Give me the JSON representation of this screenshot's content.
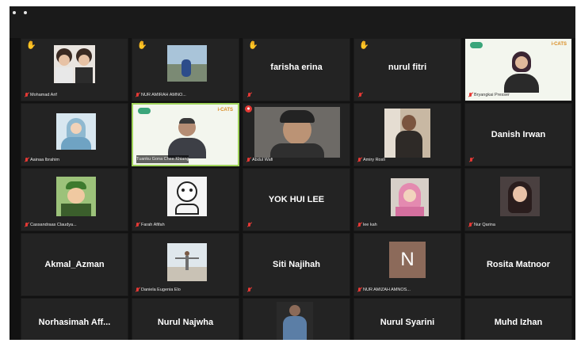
{
  "window": {
    "theme_bg": "#121212",
    "accent_active": "#9fd35a",
    "muted_color": "#e53935"
  },
  "participants": [
    {
      "label": "Mohamad Arif",
      "hand": true
    },
    {
      "label": "NUR AMIRAH AMNO...",
      "hand": true
    },
    {
      "name": "farisha erina",
      "hand": true
    },
    {
      "name": "nurul fitri",
      "hand": true
    },
    {
      "label": "Bryangkai Presser",
      "slide_brand": "i-CATS"
    },
    {
      "label": "Aainaa Ibrahim"
    },
    {
      "label": "Tuanku Gona Chee Khiang",
      "slide_brand": "i-CATS",
      "active": true
    },
    {
      "label": "Abdul Wafi",
      "cam_off_badge": "●"
    },
    {
      "label": "Amiry Rosli"
    },
    {
      "name": "Danish Irwan"
    },
    {
      "label": "Cassandraas Claudya..."
    },
    {
      "label": "Farah Afifah"
    },
    {
      "name": "YOK HUI LEE"
    },
    {
      "label": "lee kah"
    },
    {
      "label": "Nur Qarina"
    },
    {
      "name": "Akmal_Azman"
    },
    {
      "label": "Daniela Eugenia Elo"
    },
    {
      "name": "Siti Najihah"
    },
    {
      "label": "NUR AMIZAH AMNOS...",
      "initial": "N"
    },
    {
      "name": "Rosita Matnoor"
    },
    {
      "name": "Norhasimah Aff..."
    },
    {
      "name": "Nurul Najwha"
    },
    {
      "label": ""
    },
    {
      "name": "Nurul Syarini"
    },
    {
      "name": "Muhd Izhan"
    }
  ],
  "icons": {
    "hand": "raised-hand-icon",
    "mic": "mic-muted-icon"
  }
}
